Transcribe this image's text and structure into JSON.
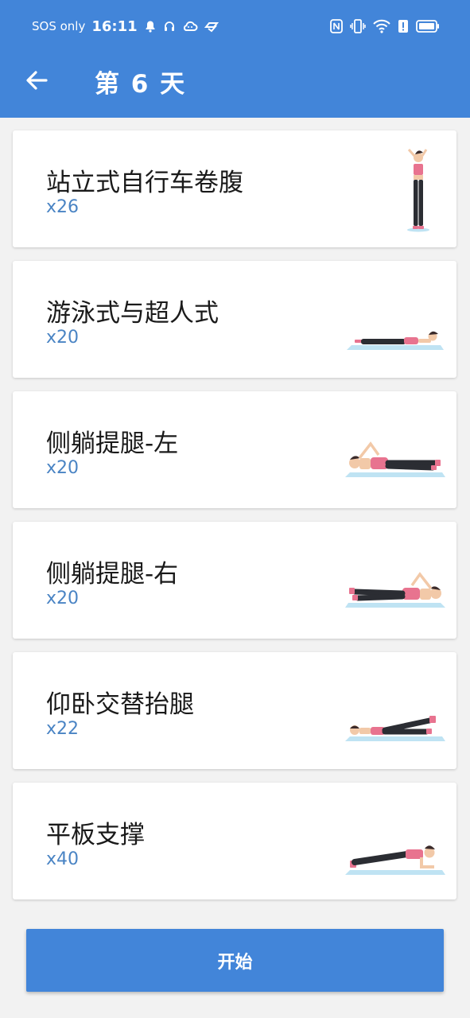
{
  "status_bar": {
    "carrier": "SOS only",
    "time": "16:11",
    "icons": [
      "bell-icon",
      "headset-icon",
      "cloud-icon",
      "app-icon",
      "nfc-icon",
      "vibrate-icon",
      "wifi-icon",
      "alert-icon",
      "battery-icon"
    ]
  },
  "header": {
    "title": "第 6 天",
    "back_icon": "arrow-left-icon"
  },
  "exercises": [
    {
      "name": "站立式自行车卷腹",
      "reps": "x26",
      "pose": "standing"
    },
    {
      "name": "游泳式与超人式",
      "reps": "x20",
      "pose": "prone"
    },
    {
      "name": "侧躺提腿-左",
      "reps": "x20",
      "pose": "side-lying-left"
    },
    {
      "name": "侧躺提腿-右",
      "reps": "x20",
      "pose": "side-lying-right"
    },
    {
      "name": "仰卧交替抬腿",
      "reps": "x22",
      "pose": "supine-leg-raise"
    },
    {
      "name": "平板支撑",
      "reps": "x40",
      "pose": "plank"
    }
  ],
  "start_button": {
    "label": "开始"
  },
  "colors": {
    "primary": "#4285d9",
    "reps_text": "#4a84c4",
    "accent_pink": "#e8738f",
    "mat": "#bfe3f3"
  }
}
